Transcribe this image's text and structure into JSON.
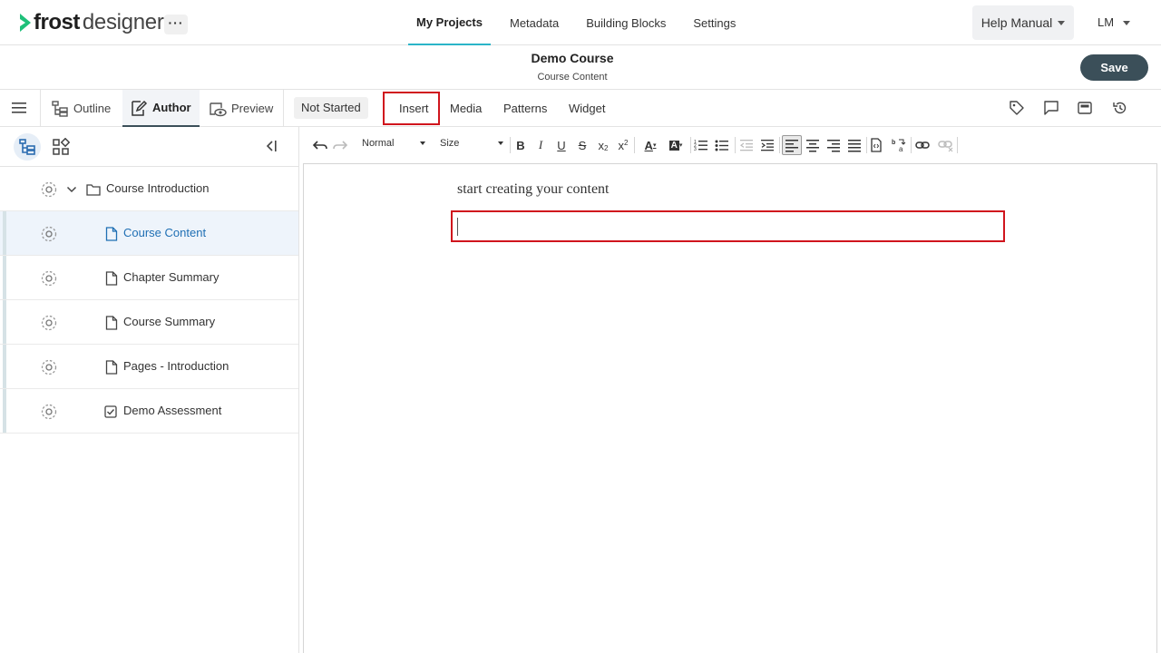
{
  "app": {
    "logo_bold": "frost",
    "logo_light": "designer",
    "more_label": "···"
  },
  "nav": {
    "items": [
      {
        "label": "My Projects",
        "active": true
      },
      {
        "label": "Metadata",
        "active": false
      },
      {
        "label": "Building Blocks",
        "active": false
      },
      {
        "label": "Settings",
        "active": false
      }
    ],
    "help_label": "Help Manual",
    "user_initials": "LM"
  },
  "project": {
    "title": "Demo Course",
    "subtitle": "Course Content",
    "save_label": "Save"
  },
  "modes": {
    "outline": "Outline",
    "author": "Author",
    "preview": "Preview",
    "status": "Not Started"
  },
  "content_tabs": {
    "insert": "Insert",
    "media": "Media",
    "patterns": "Patterns",
    "widget": "Widget"
  },
  "right_icons": [
    "tag-icon",
    "comment-icon",
    "layout-icon",
    "history-icon"
  ],
  "tree": [
    {
      "label": "Course Introduction",
      "type": "folder",
      "selected": false
    },
    {
      "label": "Course Content",
      "type": "page",
      "selected": true
    },
    {
      "label": "Chapter Summary",
      "type": "page",
      "selected": false
    },
    {
      "label": "Course Summary",
      "type": "page",
      "selected": false
    },
    {
      "label": "Pages - Introduction",
      "type": "page",
      "selected": false
    },
    {
      "label": "Demo Assessment",
      "type": "assessment",
      "selected": false
    }
  ],
  "toolbar": {
    "format_value": "Normal",
    "size_value": "Size"
  },
  "editor": {
    "placeholder_text": "start creating your content"
  },
  "colors": {
    "accent": "#2bb5c8",
    "save_bg": "#3b4f59",
    "highlight": "#d0151d",
    "selected_text": "#1f6fb4",
    "logo_green": "#1fc07a"
  }
}
